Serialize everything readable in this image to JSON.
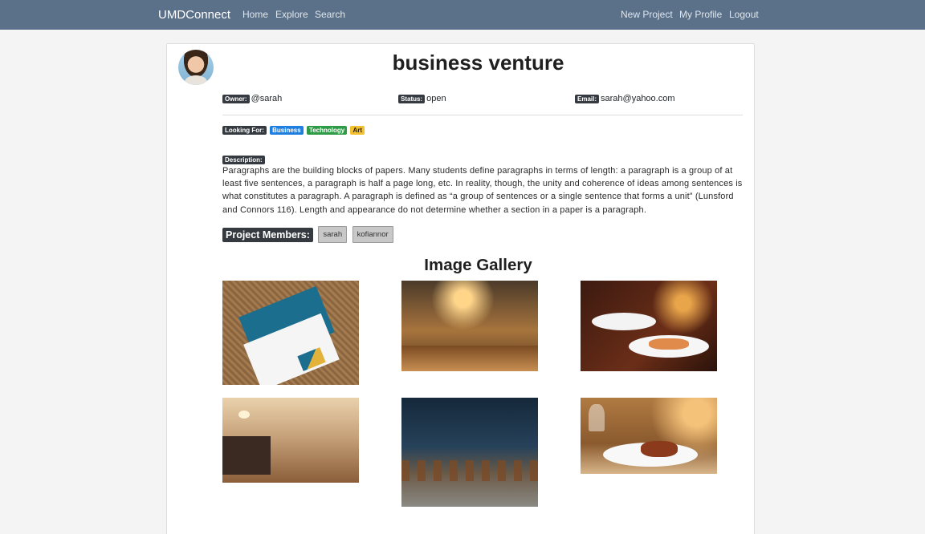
{
  "nav": {
    "brand": "UMDConnect",
    "left_links": [
      "Home",
      "Explore",
      "Search"
    ],
    "right_links": [
      "New Project",
      "My Profile",
      "Logout"
    ]
  },
  "project": {
    "title": "business venture",
    "owner_label": "Owner:",
    "owner": "@sarah",
    "status_label": "Status:",
    "status": "open",
    "email_label": "Email:",
    "email": "sarah@yahoo.com",
    "looking_for_label": "Looking For:",
    "looking_for": [
      "Business",
      "Technology",
      "Art"
    ],
    "description_label": "Description:",
    "description": "Paragraphs are the building blocks of papers. Many students define paragraphs in terms of length: a paragraph is a group of at least five sentences, a paragraph is half a page long, etc. In reality, though, the unity and coherence of ideas among sentences is what constitutes a paragraph. A paragraph is defined as “a group of sentences or a single sentence that forms a unit” (Lunsford and Connors 116). Length and appearance do not determine whether a section in a paper is a paragraph.",
    "members_label": "Project Members:",
    "members": [
      "sarah",
      "kofiannor"
    ]
  },
  "gallery": {
    "title": "Image Gallery"
  },
  "colors": {
    "navbar": "#5b7189",
    "tag_business": "#1e7fe0",
    "tag_technology": "#2f9b47",
    "tag_art": "#f4c12e"
  }
}
